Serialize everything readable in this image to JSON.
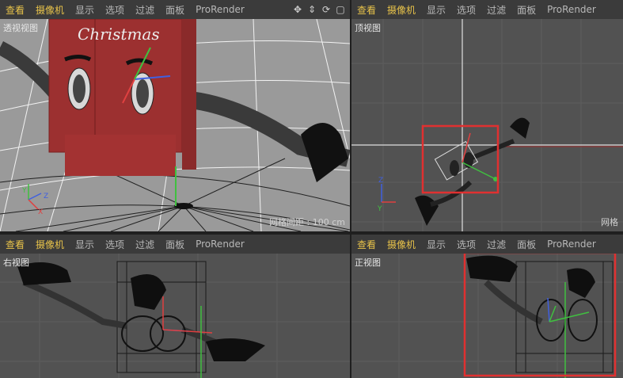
{
  "menu": [
    "查看",
    "摄像机",
    "显示",
    "选项",
    "过滤",
    "面板",
    "ProRender"
  ],
  "toolbar_icons": [
    "move-icon",
    "zoom-icon",
    "rotate-icon",
    "maximize-icon"
  ],
  "viewports": {
    "perspective": {
      "label": "透视视图",
      "grid_info": "网格间距 : 100 cm",
      "decal_text": "Christmas"
    },
    "top": {
      "label": "顶视图",
      "grid_info": "网格"
    },
    "right": {
      "label": "右视图"
    },
    "front": {
      "label": "正视图"
    }
  },
  "axis_letters": {
    "x": "X",
    "y": "Y",
    "z": "Z"
  },
  "colors": {
    "menu_highlight": "#e8c34a",
    "selection_frame": "#e03030",
    "axis_x": "#e04040",
    "axis_y": "#40c040",
    "axis_z": "#4060e0"
  }
}
